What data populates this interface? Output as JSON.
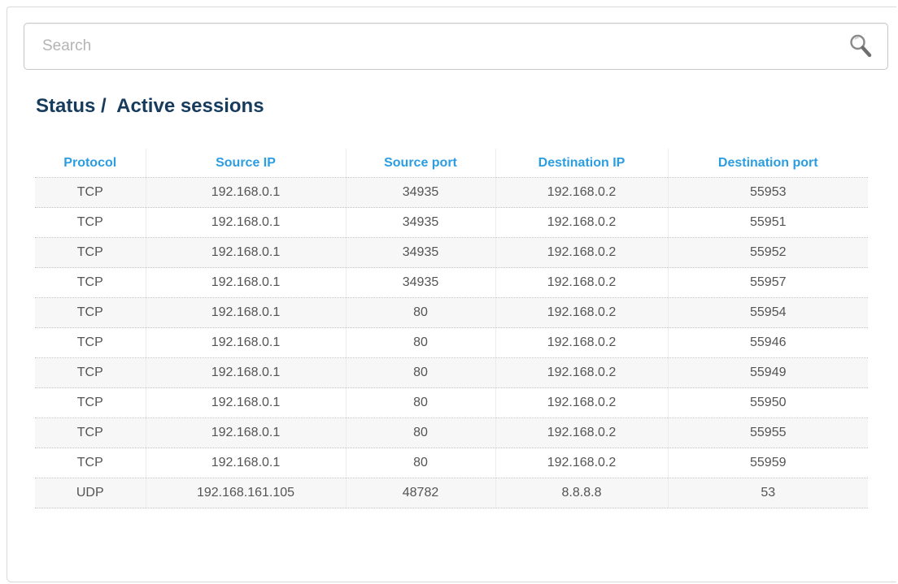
{
  "search": {
    "placeholder": "Search",
    "value": ""
  },
  "page": {
    "title": "Status /  Active sessions"
  },
  "table": {
    "headers": [
      "Protocol",
      "Source IP",
      "Source port",
      "Destination IP",
      "Destination port"
    ],
    "rows": [
      [
        "TCP",
        "192.168.0.1",
        "34935",
        "192.168.0.2",
        "55953"
      ],
      [
        "TCP",
        "192.168.0.1",
        "34935",
        "192.168.0.2",
        "55951"
      ],
      [
        "TCP",
        "192.168.0.1",
        "34935",
        "192.168.0.2",
        "55952"
      ],
      [
        "TCP",
        "192.168.0.1",
        "34935",
        "192.168.0.2",
        "55957"
      ],
      [
        "TCP",
        "192.168.0.1",
        "80",
        "192.168.0.2",
        "55954"
      ],
      [
        "TCP",
        "192.168.0.1",
        "80",
        "192.168.0.2",
        "55946"
      ],
      [
        "TCP",
        "192.168.0.1",
        "80",
        "192.168.0.2",
        "55949"
      ],
      [
        "TCP",
        "192.168.0.1",
        "80",
        "192.168.0.2",
        "55950"
      ],
      [
        "TCP",
        "192.168.0.1",
        "80",
        "192.168.0.2",
        "55955"
      ],
      [
        "TCP",
        "192.168.0.1",
        "80",
        "192.168.0.2",
        "55959"
      ],
      [
        "UDP",
        "192.168.161.105",
        "48782",
        "8.8.8.8",
        "53"
      ]
    ]
  },
  "icons": {
    "search": "search-icon"
  },
  "colors": {
    "title": "#173b5c",
    "header_text": "#2b9de0",
    "cell_text": "#545454",
    "row_stripe": "#f7f7f7"
  }
}
